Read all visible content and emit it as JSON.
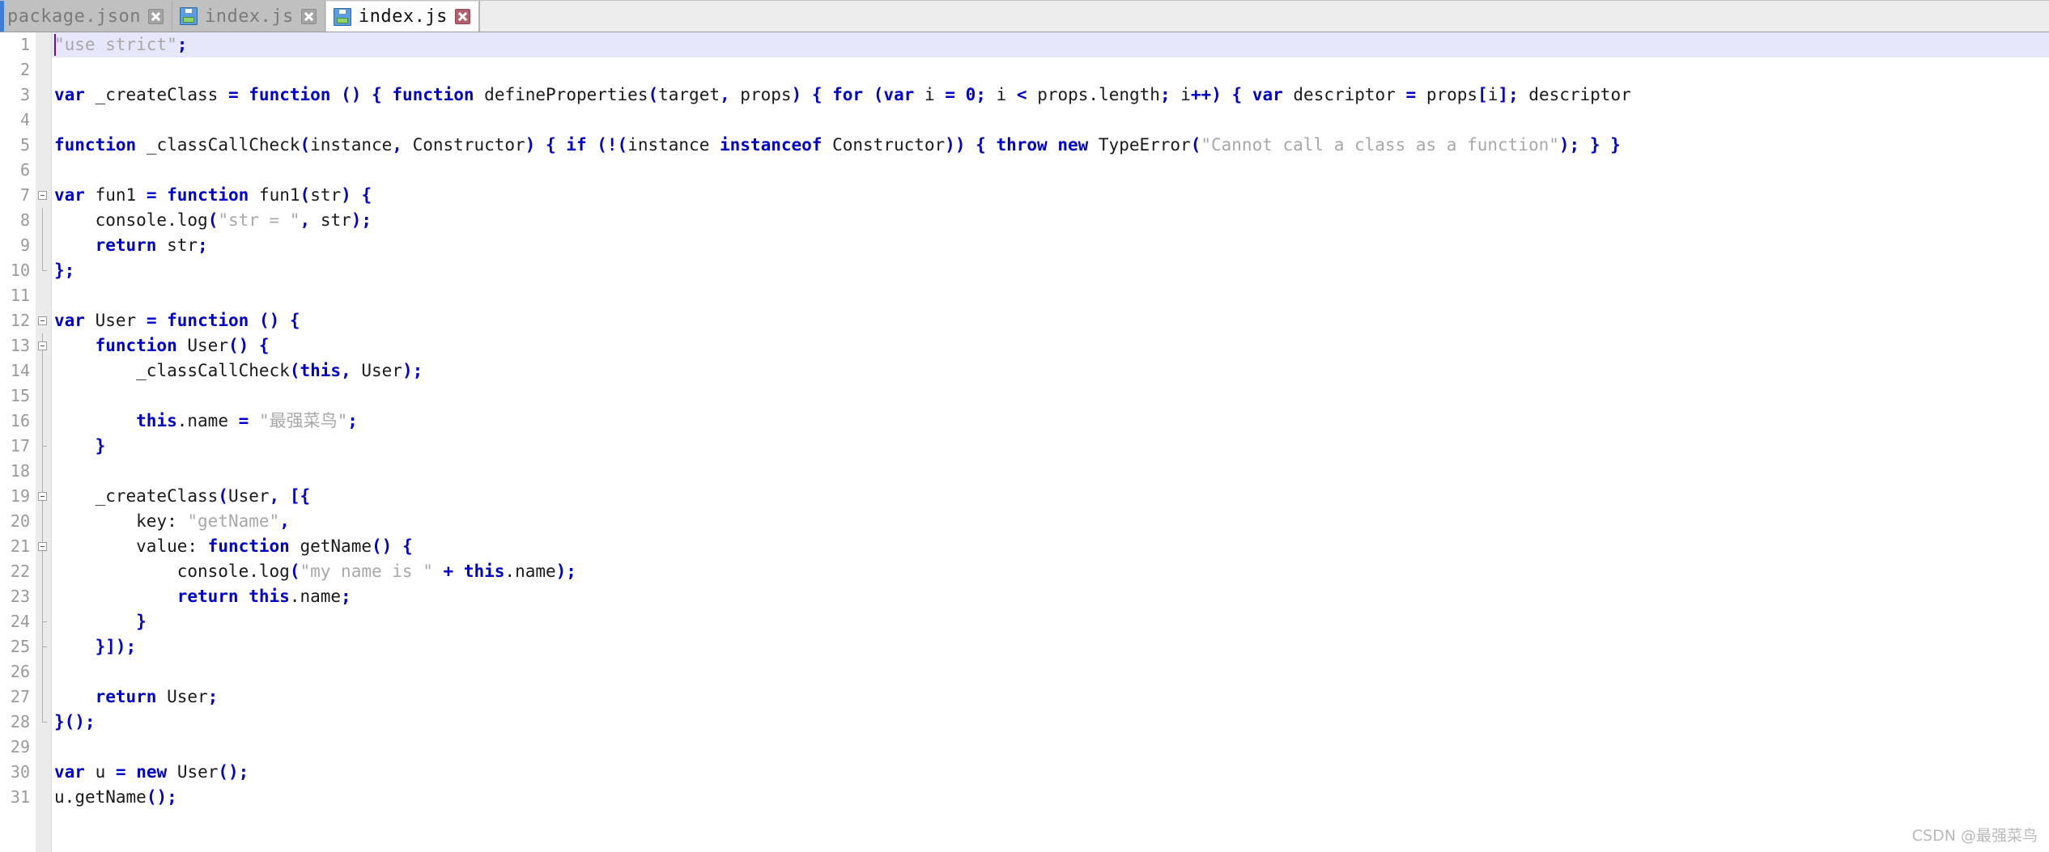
{
  "tabbar": {
    "tabs": [
      {
        "label": "package.json",
        "active": false,
        "dirty": false,
        "close_icon": "close-icon",
        "file_icon": "floppy-disk-icon"
      },
      {
        "label": "index.js",
        "active": false,
        "dirty": false,
        "close_icon": "close-icon",
        "file_icon": "floppy-disk-icon"
      },
      {
        "label": "index.js",
        "active": true,
        "dirty": false,
        "close_icon": "close-icon",
        "file_icon": "floppy-disk-icon"
      }
    ]
  },
  "editor": {
    "current_line": 1,
    "total_lines": 31,
    "line_numbers": [
      "1",
      "2",
      "3",
      "4",
      "5",
      "6",
      "7",
      "8",
      "9",
      "10",
      "11",
      "12",
      "13",
      "14",
      "15",
      "16",
      "17",
      "18",
      "19",
      "20",
      "21",
      "22",
      "23",
      "24",
      "25",
      "26",
      "27",
      "28",
      "29",
      "30",
      "31"
    ],
    "lines": [
      {
        "n": 1,
        "text": "\"use strict\";"
      },
      {
        "n": 2,
        "text": ""
      },
      {
        "n": 3,
        "text": "var _createClass = function () { function defineProperties(target, props) { for (var i = 0; i < props.length; i++) { var descriptor = props[i]; descriptor"
      },
      {
        "n": 4,
        "text": ""
      },
      {
        "n": 5,
        "text": "function _classCallCheck(instance, Constructor) { if (!(instance instanceof Constructor)) { throw new TypeError(\"Cannot call a class as a function\"); } }"
      },
      {
        "n": 6,
        "text": ""
      },
      {
        "n": 7,
        "text": "var fun1 = function fun1(str) {"
      },
      {
        "n": 8,
        "text": "    console.log(\"str = \", str);"
      },
      {
        "n": 9,
        "text": "    return str;"
      },
      {
        "n": 10,
        "text": "};"
      },
      {
        "n": 11,
        "text": ""
      },
      {
        "n": 12,
        "text": "var User = function () {"
      },
      {
        "n": 13,
        "text": "    function User() {"
      },
      {
        "n": 14,
        "text": "        _classCallCheck(this, User);"
      },
      {
        "n": 15,
        "text": ""
      },
      {
        "n": 16,
        "text": "        this.name = \"最强菜鸟\";"
      },
      {
        "n": 17,
        "text": "    }"
      },
      {
        "n": 18,
        "text": ""
      },
      {
        "n": 19,
        "text": "    _createClass(User, [{"
      },
      {
        "n": 20,
        "text": "        key: \"getName\","
      },
      {
        "n": 21,
        "text": "        value: function getName() {"
      },
      {
        "n": 22,
        "text": "            console.log(\"my name is \" + this.name);"
      },
      {
        "n": 23,
        "text": "            return this.name;"
      },
      {
        "n": 24,
        "text": "        }"
      },
      {
        "n": 25,
        "text": "    }]);"
      },
      {
        "n": 26,
        "text": ""
      },
      {
        "n": 27,
        "text": "    return User;"
      },
      {
        "n": 28,
        "text": "}();"
      },
      {
        "n": 29,
        "text": ""
      },
      {
        "n": 30,
        "text": "var u = new User();"
      },
      {
        "n": 31,
        "text": "u.getName();"
      }
    ],
    "fold_markers": [
      7,
      12,
      13,
      19,
      21
    ],
    "colors": {
      "keyword": "#0000cd",
      "string": "#a8a8a8",
      "identifier": "#1a1a1a",
      "current_line_bg": "#e7e7fb",
      "caret": "#6a0dad",
      "gutter_text": "#9a9a9a",
      "tabbar_bg": "#c0c0c0",
      "active_tab_bg": "#fdfdfd"
    }
  },
  "watermark": {
    "text": "CSDN @最强菜鸟"
  }
}
